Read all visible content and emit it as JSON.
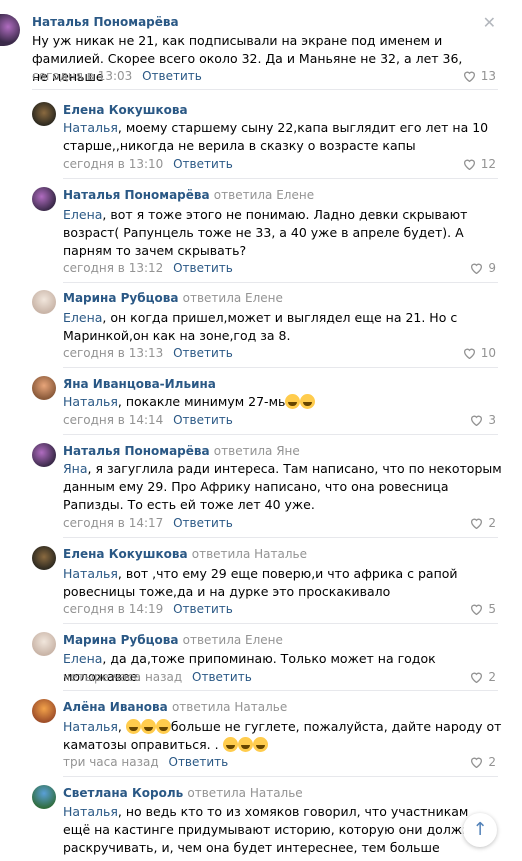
{
  "colors": {
    "link": "#2a5885",
    "meta": "#939393",
    "separator": "#e7e8ec",
    "accent": "#5181b8"
  },
  "reply_label": "Ответить",
  "comments": [
    {
      "author": "Наталья Пономарёва",
      "reply_to": "",
      "mention": "",
      "text": "Ну уж никак не 21, как подписывали на экране под именем и фамилией. Скорее всего около 32. Да и Маньяне не 32, а лет 36, не меньше",
      "time": "сегодня в 13:03",
      "likes": "13"
    },
    {
      "author": "Елена Кокушкова",
      "reply_to": "",
      "mention": "Наталья",
      "text": ", моему старшему сыну 22,капа выглядит его лет на 10 старше,,никогда не верила в сказку о возрасте капы",
      "time": "сегодня в 13:10",
      "likes": "12"
    },
    {
      "author": "Наталья Пономарёва",
      "reply_to": "ответила Елене",
      "mention": "Елена",
      "text": ", вот я тоже этого не понимаю. Ладно девки скрывают возраст( Рапунцель тоже не 33, а 40 уже в апреле будет). А парням то зачем скрывать?",
      "time": "сегодня в 13:12",
      "likes": "9"
    },
    {
      "author": "Марина Рубцова",
      "reply_to": "ответила Елене",
      "mention": "Елена",
      "text": ", он когда пришел,может и выглядел еще на 21. Но с Маринкой,он как на зоне,год за 8.",
      "time": "сегодня в 13:13",
      "likes": "10"
    },
    {
      "author": "Яна Иванцова-Ильина",
      "reply_to": "",
      "mention": "Наталья",
      "text": ", покакле минимум 27-мь",
      "time": "сегодня в 14:14",
      "likes": "3"
    },
    {
      "author": "Наталья Пономарёва",
      "reply_to": "ответила Яне",
      "mention": "Яна",
      "text": ", я загуглила ради интереса. Там написано, что по некоторым данным ему 29. Про Африку написано, что она ровесница Рапизды. То есть ей тоже лет 40 уже.",
      "time": "сегодня в 14:17",
      "likes": "2"
    },
    {
      "author": "Елена Кокушкова",
      "reply_to": "ответила Наталье",
      "mention": "Наталья",
      "text": ", вот ,что ему 29 еще поверю,и что африка с рапой ровесницы тоже,да и на дурке это проскакивало",
      "time": "сегодня в 14:19",
      "likes": "5"
    },
    {
      "author": "Марина Рубцова",
      "reply_to": "ответила Елене",
      "mention": "Елена",
      "text": ", да да,тоже припоминаю. Только может на годок моложавее.",
      "time": "четыре часа назад",
      "likes": "2"
    },
    {
      "author": "Алёна Иванова",
      "reply_to": "ответила Наталье",
      "mention": "Наталья",
      "text": "больше не гуглете, пожалуйста, дайте народу от каматозы оправиться. .",
      "time": "три часа назад",
      "likes": "2"
    },
    {
      "author": "Светлана Король",
      "reply_to": "ответила Наталье",
      "mention": "Наталья",
      "text": ", но ведь кто то из хомяков говорил, что участникам ещё на кастинге придумывают историю, которую они должны раскручивать, и, чем она будет интереснее, тем больше гонорар!",
      "time": "",
      "likes": ""
    }
  ]
}
